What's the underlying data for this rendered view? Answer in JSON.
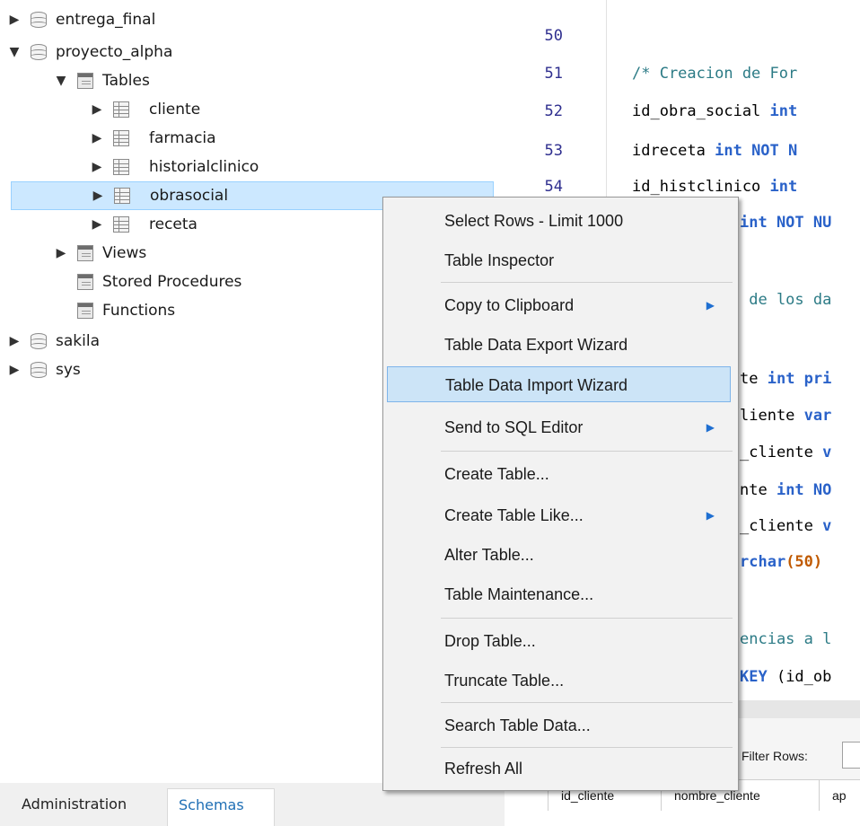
{
  "navigator": {
    "schemas": [
      {
        "name": "entrega_final",
        "expanded": false
      },
      {
        "name": "proyecto_alpha",
        "expanded": true
      },
      {
        "name": "sakila",
        "expanded": false
      },
      {
        "name": "sys",
        "expanded": false
      }
    ],
    "tables_folder": "Tables",
    "tables": [
      "cliente",
      "farmacia",
      "historialclinico",
      "obrasocial",
      "receta"
    ],
    "selected_table": "obrasocial",
    "views_folder": "Views",
    "stored_procedures": "Stored Procedures",
    "functions": "Functions",
    "tabs": {
      "administration": "Administration",
      "schemas": "Schemas"
    }
  },
  "editor": {
    "line_numbers": [
      "50",
      "51",
      "52",
      "53",
      "54"
    ],
    "lines": [
      {
        "text": ""
      },
      {
        "comment": "/* Creacion de For"
      },
      {
        "plain": "id_obra_social ",
        "kw": "int"
      },
      {
        "plain": "idreceta ",
        "kw": "int NOT N"
      },
      {
        "plain": "id_histclinico ",
        "kw": "int"
      }
    ],
    "visible_fragments": [
      {
        "plain": "",
        "kw": "int NOT NU"
      },
      {
        "plain": "",
        "kw": ""
      },
      {
        "plain": " de los da",
        "kw": ""
      },
      {
        "plain": "",
        "kw": ""
      },
      {
        "plain": "te ",
        "kw": "int pri"
      },
      {
        "plain": "liente ",
        "kw": "var"
      },
      {
        "plain": "_cliente ",
        "kw": "v"
      },
      {
        "plain": "nte ",
        "kw": "int NO"
      },
      {
        "plain": "_cliente ",
        "kw": "v"
      },
      {
        "plain": "",
        "kw": "rchar",
        "num": "(50)"
      },
      {
        "plain": "",
        "kw": ""
      },
      {
        "plain": "encias a l",
        "kw": ""
      },
      {
        "plain": "",
        "kw": "KEY",
        "tail": " (id_ob"
      }
    ]
  },
  "result_panel": {
    "filter_label": "Filter Rows:",
    "columns": [
      "id_cliente",
      "nombre_cliente",
      "ap"
    ]
  },
  "context_menu": {
    "items": [
      {
        "label": "Select Rows - Limit 1000",
        "submenu": false
      },
      {
        "label": "Table Inspector",
        "submenu": false
      },
      {
        "label": "Copy to Clipboard",
        "submenu": true
      },
      {
        "label": "Table Data Export Wizard",
        "submenu": false
      },
      {
        "label": "Table Data Import Wizard",
        "submenu": false,
        "highlighted": true
      },
      {
        "label": "Send to SQL Editor",
        "submenu": true
      },
      {
        "label": "Create Table...",
        "submenu": false
      },
      {
        "label": "Create Table Like...",
        "submenu": true
      },
      {
        "label": "Alter Table...",
        "submenu": false
      },
      {
        "label": "Table Maintenance...",
        "submenu": false
      },
      {
        "label": "Drop Table...",
        "submenu": false
      },
      {
        "label": "Truncate Table...",
        "submenu": false
      },
      {
        "label": "Search Table Data...",
        "submenu": false
      },
      {
        "label": "Refresh All",
        "submenu": false
      }
    ]
  },
  "colors": {
    "selection": "#cce8ff",
    "menu_highlight": "#cce4f7",
    "keyword": "#2a62c9",
    "comment": "#2c7b86",
    "number": "#c05a00",
    "tab_active": "#1f6fb5"
  }
}
